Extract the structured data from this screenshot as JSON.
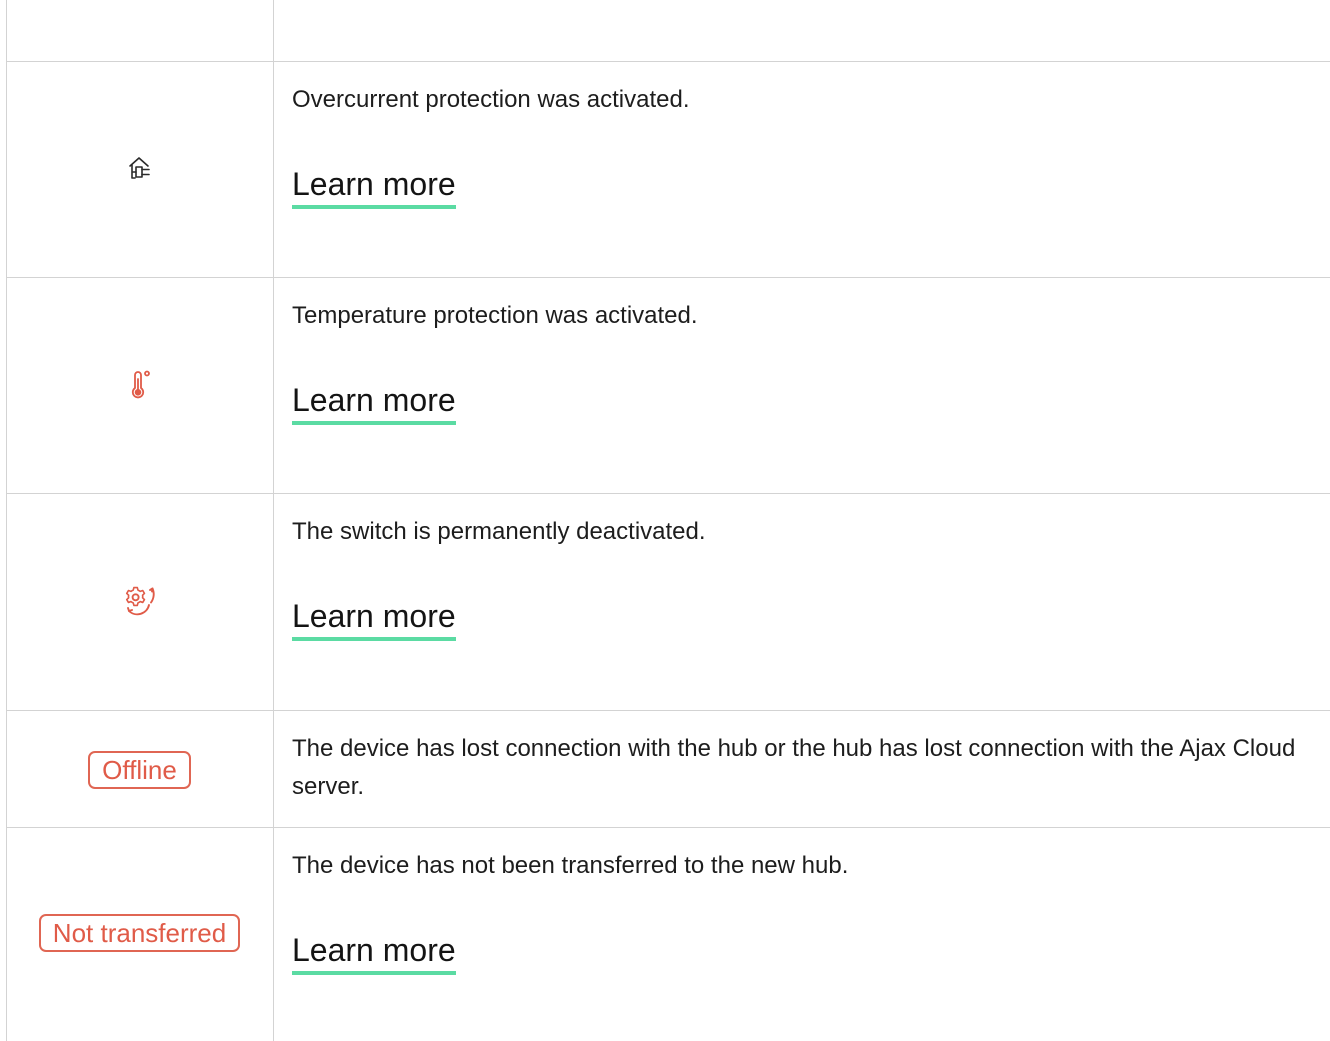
{
  "rows": [
    {
      "icon": "plug-house-icon",
      "description": "Overcurrent protection was activated.",
      "link": "Learn more"
    },
    {
      "icon": "thermometer-icon",
      "description": "Temperature protection was activated.",
      "link": "Learn more"
    },
    {
      "icon": "gear-arrow-icon",
      "description": "The switch is permanently deactivated.",
      "link": "Learn more"
    },
    {
      "badge": "Offline",
      "description": "The device has lost connection with the hub or the hub has lost connection with the Ajax Cloud server."
    },
    {
      "badge": "Not transferred",
      "description": "The device has not been transferred to the new hub.",
      "link": "Learn more"
    }
  ],
  "colors": {
    "accent_underline": "#5bdba3",
    "warning": "#e05b48",
    "border": "#d3d3d3"
  }
}
